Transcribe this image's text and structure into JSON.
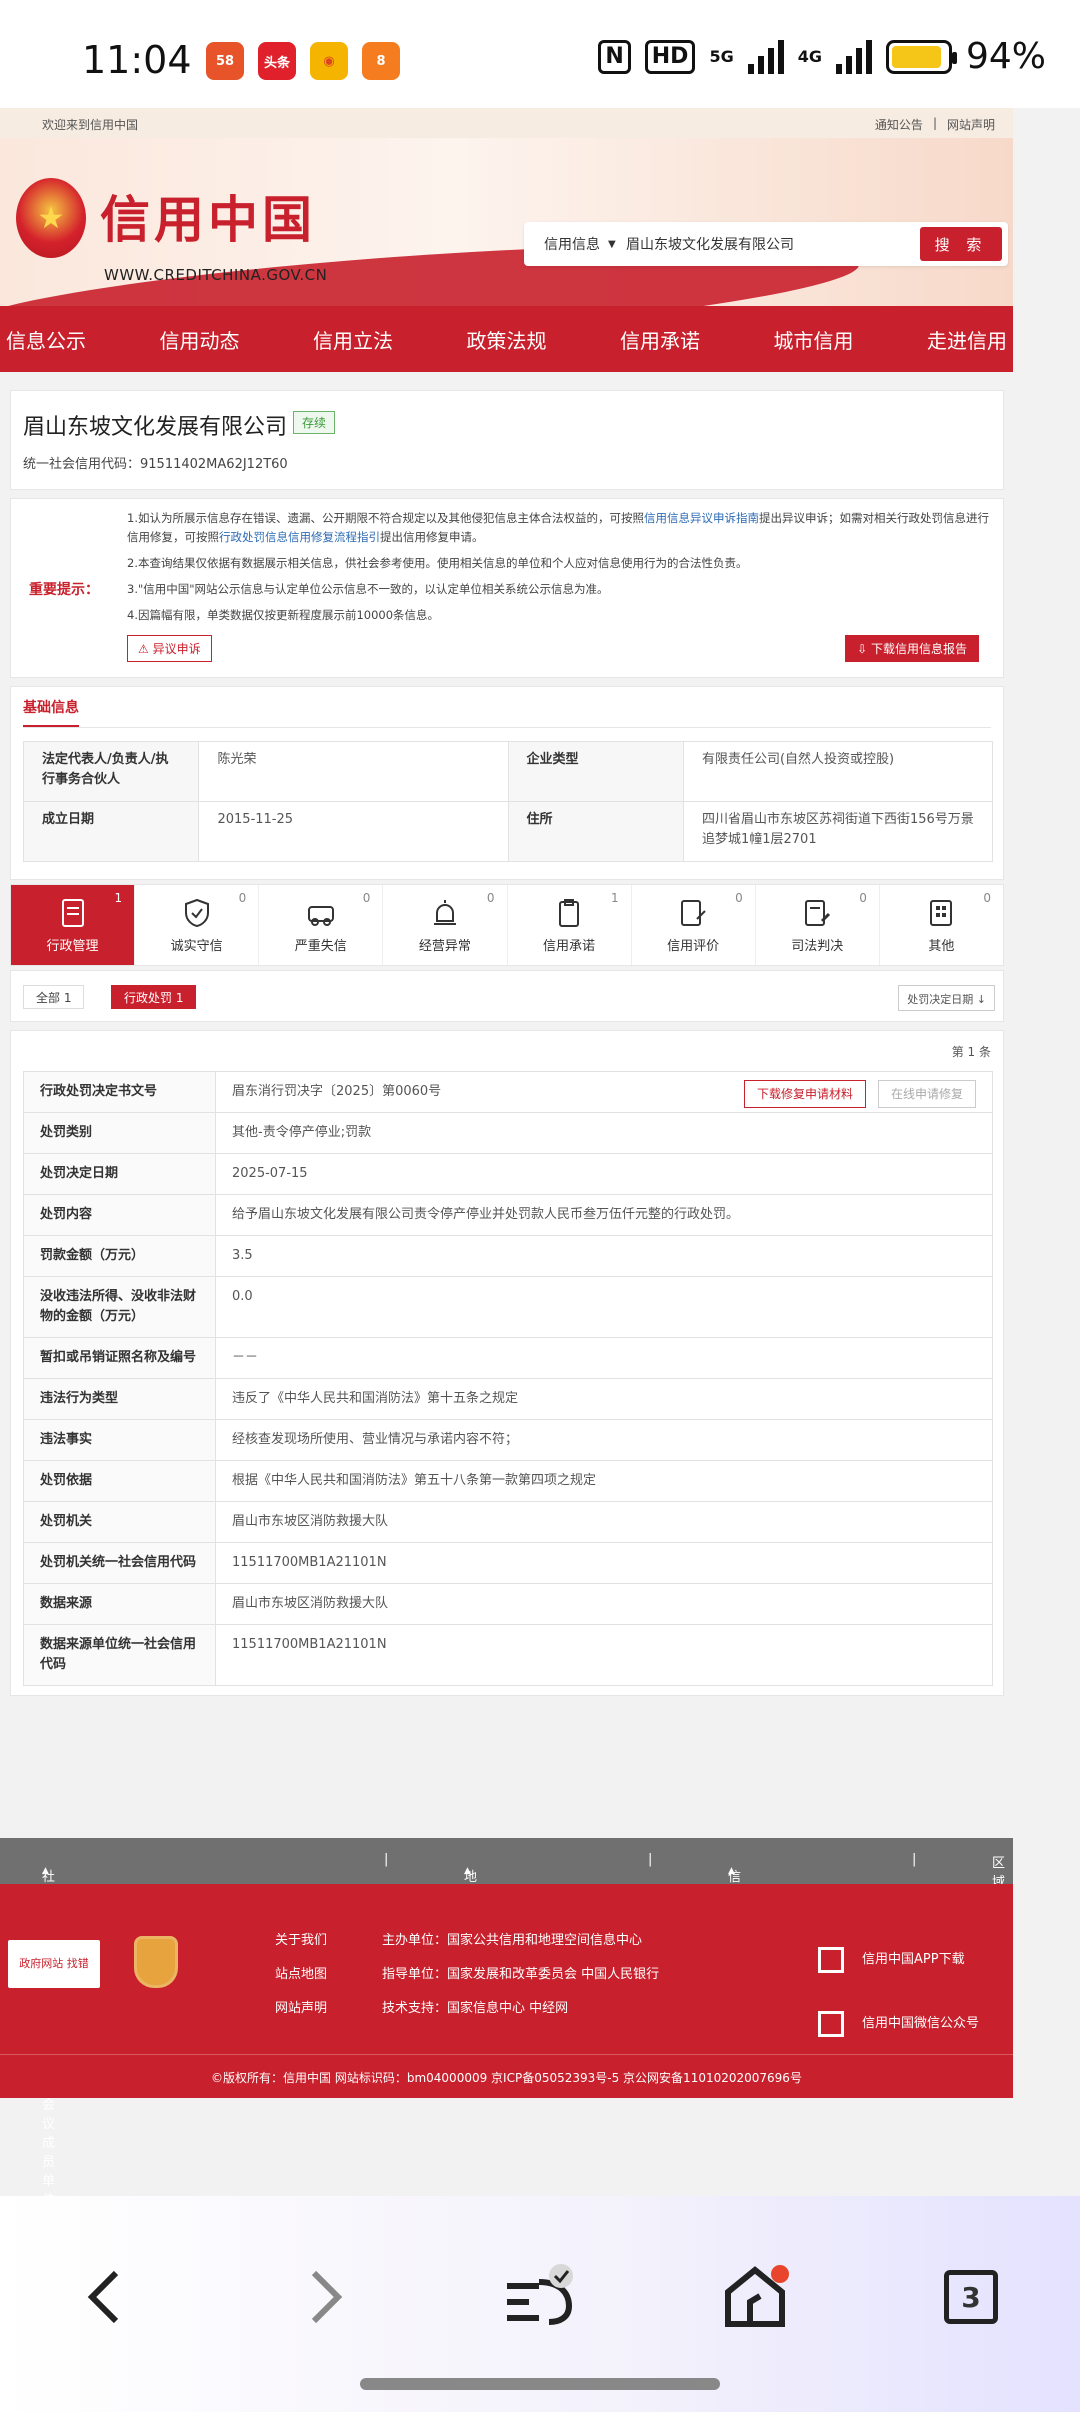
{
  "status_bar": {
    "time": "11:04",
    "battery": "94%",
    "net1": "5G",
    "net2": "4G",
    "hd": "HD",
    "app1": "58",
    "app2": "头条",
    "app4": "8"
  },
  "site": {
    "welcome": "欢迎来到信用中国",
    "top_links": [
      "通知公告",
      "|",
      "网站声明"
    ],
    "logo_cn": "信用中国",
    "logo_en": "WWW.CREDITCHINA.GOV.CN",
    "search": {
      "type": "信用信息",
      "value": "眉山东坡文化发展有限公司",
      "button": "搜 索"
    },
    "nav": [
      "信息公示",
      "信用动态",
      "信用立法",
      "政策法规",
      "信用承诺",
      "城市信用",
      "走进信用"
    ]
  },
  "company": {
    "name": "眉山东坡文化发展有限公司",
    "status": "存续",
    "code_label": "统一社会信用代码：",
    "code": "91511402MA62J12T60"
  },
  "notice": {
    "label": "重要提示：",
    "item1_a": "1.如认为所展示信息存在错误、遗漏、公开期限不符合规定以及其他侵犯信息主体合法权益的，可按照",
    "item1_link1": "信用信息异议申诉指南",
    "item1_b": "提出异议申诉；如需对相关行政处罚信息进行信用修复，可按照",
    "item1_link2": "行政处罚信息信用修复流程指引",
    "item1_c": "提出信用修复申请。",
    "item2": "2.本查询结果仅依据有数据展示相关信息，供社会参考使用。使用相关信息的单位和个人应对信息使用行为的合法性负责。",
    "item3": "3.\"信用中国\"网站公示信息与认定单位公示信息不一致的，以认定单位相关系统公示信息为准。",
    "item4": "4.因篇幅有限，单类数据仅按更新程度展示前10000条信息。",
    "appeal_button": "异议申诉",
    "download_button": "下载信用信息报告"
  },
  "basic": {
    "title": "基础信息",
    "rows": [
      {
        "k1": "法定代表人/负责人/执行事务合伙人",
        "v1": "陈光荣",
        "k2": "企业类型",
        "v2": "有限责任公司(自然人投资或控股)"
      },
      {
        "k1": "成立日期",
        "v1": "2015-11-25",
        "k2": "住所",
        "v2": "四川省眉山市东坡区苏祠街道下西街156号万景追梦城1幢1层2701"
      }
    ]
  },
  "tabs": [
    {
      "label": "行政管理",
      "count": "1"
    },
    {
      "label": "诚实守信",
      "count": "0"
    },
    {
      "label": "严重失信",
      "count": "0"
    },
    {
      "label": "经营异常",
      "count": "0"
    },
    {
      "label": "信用承诺",
      "count": "1"
    },
    {
      "label": "信用评价",
      "count": "0"
    },
    {
      "label": "司法判决",
      "count": "0"
    },
    {
      "label": "其他",
      "count": "0"
    }
  ],
  "filters": {
    "all": "全部  1",
    "penalty": "行政处罚  1",
    "sort": "处罚决定日期"
  },
  "detail": {
    "page_info": "第 1 条",
    "repair_doc_button": "下载修复申请材料",
    "online_repair_button": "在线申请修复",
    "rows": [
      {
        "k": "行政处罚决定书文号",
        "v": "眉东消行罚决字〔2025〕第0060号"
      },
      {
        "k": "处罚类别",
        "v": "其他-责令停产停业;罚款"
      },
      {
        "k": "处罚决定日期",
        "v": "2025-07-15"
      },
      {
        "k": "处罚内容",
        "v": "给予眉山东坡文化发展有限公司责令停产停业并处罚款人民币叁万伍仟元整的行政处罚。"
      },
      {
        "k": "罚款金额（万元）",
        "v": "3.5"
      },
      {
        "k": "没收违法所得、没收非法财物的金额（万元）",
        "v": "0.0"
      },
      {
        "k": "暂扣或吊销证照名称及编号",
        "v": "－－"
      },
      {
        "k": "违法行为类型",
        "v": "违反了《中华人民共和国消防法》第十五条之规定"
      },
      {
        "k": "违法事实",
        "v": "经核查发现场所使用、营业情况与承诺内容不符；"
      },
      {
        "k": "处罚依据",
        "v": "根据《中华人民共和国消防法》第五十八条第一款第四项之规定"
      },
      {
        "k": "处罚机关",
        "v": "眉山市东坡区消防救援大队"
      },
      {
        "k": "处罚机关统一社会信用代码",
        "v": "11511700MB1A21101N"
      },
      {
        "k": "数据来源",
        "v": "眉山市东坡区消防救援大队"
      },
      {
        "k": "数据来源单位统一社会信用代码",
        "v": "11511700MB1A21101N"
      }
    ]
  },
  "footer": {
    "bar": [
      "社会信用体系建设部际联席会议成员单位",
      "|",
      "地方信用网站",
      "|",
      "信用示范地区",
      "|",
      "区域"
    ],
    "gov_badge": "政府网站 找错",
    "links": [
      "关于我们",
      "站点地图",
      "网站声明"
    ],
    "host": "主办单位：国家公共信用和地理空间信息中心",
    "guide": "指导单位：国家发展和改革委员会 中国人民银行",
    "tech": "技术支持：国家信息中心 中经网",
    "app": "信用中国APP下载",
    "wechat": "信用中国微信公众号",
    "copyright": "©版权所有：信用中国     网站标识码：bm04000009     京ICP备05052393号-5     京公网安备11010202007696号"
  },
  "browser": {
    "tab_count": "3"
  }
}
